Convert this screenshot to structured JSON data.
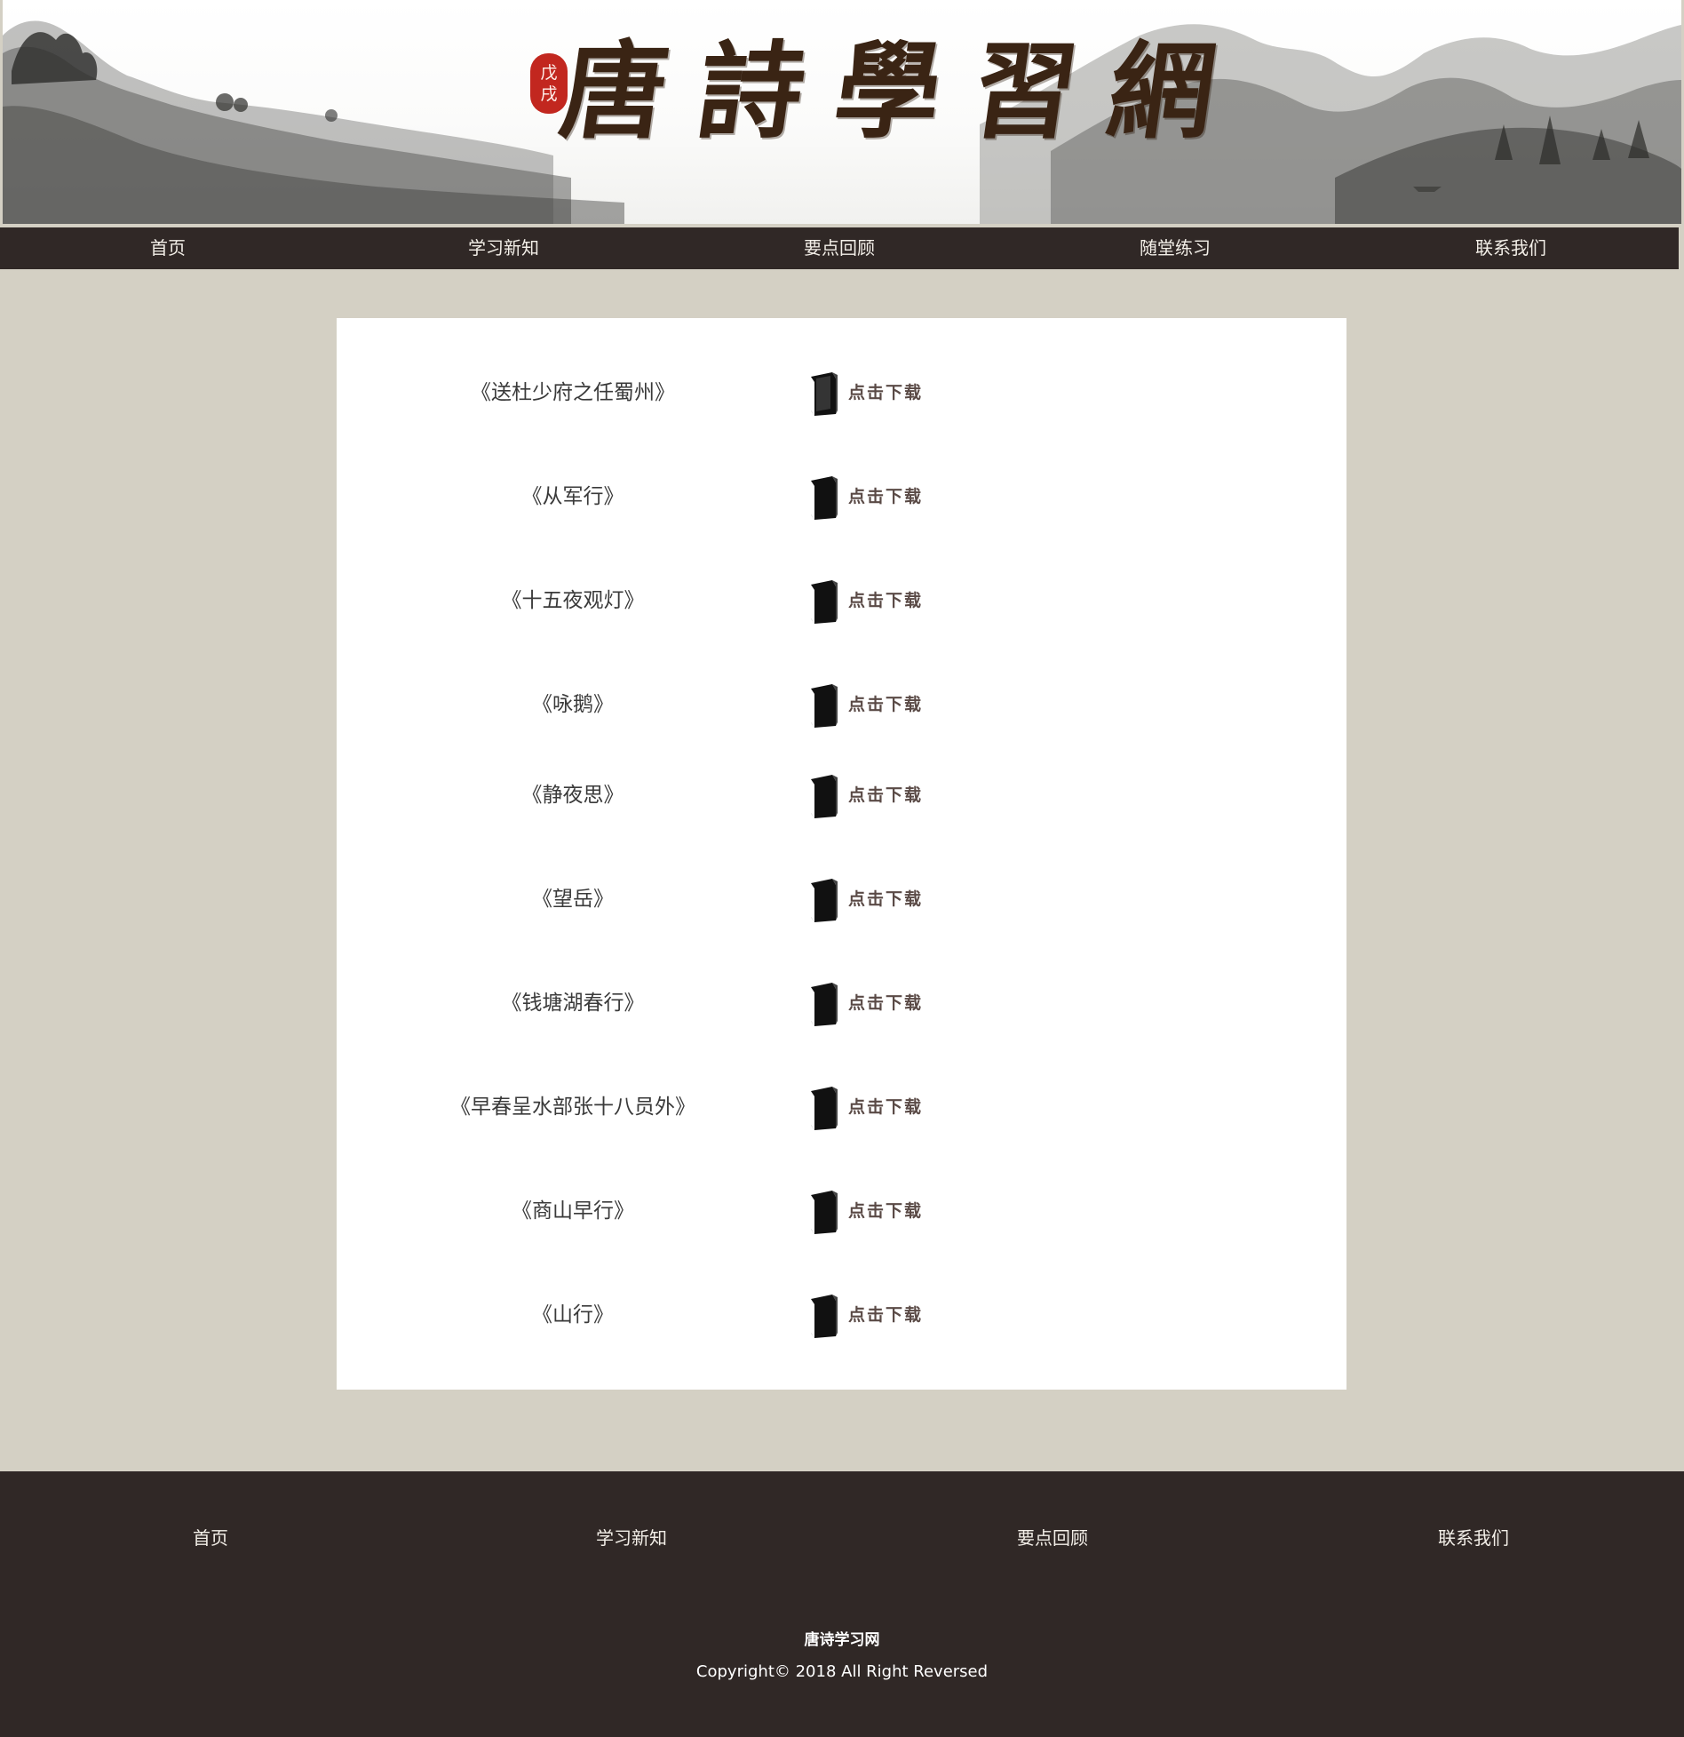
{
  "header": {
    "title": "唐詩學習網",
    "seal_text": [
      "戊",
      "戌"
    ]
  },
  "topnav": {
    "items": [
      "首页",
      "学习新知",
      "要点回顾",
      "随堂练习",
      "联系我们"
    ]
  },
  "downloads": {
    "button_label": "点击下载",
    "items": [
      "《送杜少府之任蜀州》",
      "《从军行》",
      "《十五夜观灯》",
      "《咏鹅》",
      "《静夜思》",
      "《望岳》",
      "《钱塘湖春行》",
      "《早春呈水部张十八员外》",
      "《商山早行》",
      "《山行》"
    ]
  },
  "footer": {
    "nav_items": [
      "首页",
      "学习新知",
      "要点回顾",
      "联系我们"
    ],
    "site_name": "唐诗学习网",
    "copyright": "Copyright© 2018 All Right Reversed"
  },
  "colors": {
    "page_background": "#d4d0c4",
    "nav_background": "#302826",
    "nav_text": "#f3efe8",
    "title_brown": "#3a2414",
    "seal_red": "#c2271f"
  }
}
